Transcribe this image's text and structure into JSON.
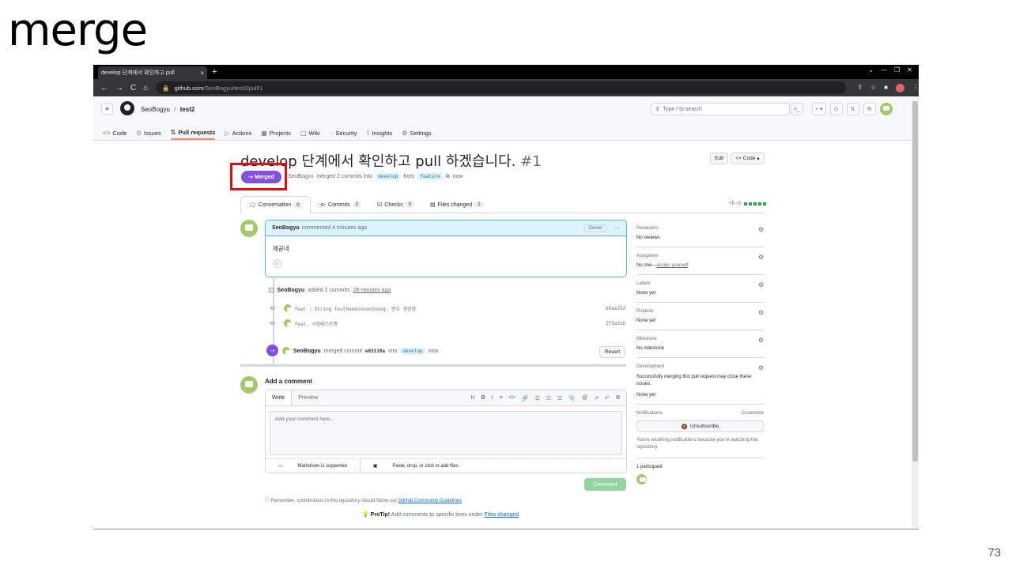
{
  "slide": {
    "title": "merge",
    "page_number": "73"
  },
  "browser": {
    "tab_title": "develop 단계에서 확인하고 pull",
    "tab_close": "×",
    "new_tab": "+",
    "url_host": "github.com",
    "url_path": "/SeoBogyu/test2/pull/1",
    "window_controls": [
      "⌄",
      "—",
      "❐",
      "✕"
    ]
  },
  "github_header": {
    "owner": "SeoBogyu",
    "separator": "/",
    "repo": "test2",
    "search_placeholder": "Type / to search",
    "search_slash": "/",
    "plus": "+ ▾"
  },
  "repo_tabs": [
    {
      "label": "Code",
      "icon": "code-icon",
      "glyph": "<>"
    },
    {
      "label": "Issues",
      "icon": "issue-icon",
      "glyph": "⊙"
    },
    {
      "label": "Pull requests",
      "icon": "pull-request-icon",
      "glyph": "⇅"
    },
    {
      "label": "Actions",
      "icon": "play-icon",
      "glyph": "▷"
    },
    {
      "label": "Projects",
      "icon": "table-icon",
      "glyph": "▦"
    },
    {
      "label": "Wiki",
      "icon": "book-icon",
      "glyph": "▢"
    },
    {
      "label": "Security",
      "icon": "shield-icon",
      "glyph": "◌"
    },
    {
      "label": "Insights",
      "icon": "graph-icon",
      "glyph": "⌇"
    },
    {
      "label": "Settings",
      "icon": "gear-icon",
      "glyph": "⚙"
    }
  ],
  "pr": {
    "title": "develop 단계에서 확인하고 pull 하겠습니다.",
    "number": "#1",
    "status_badge": "Merged",
    "author": "SeoBogyu",
    "merge_text": "merged 2 commits into",
    "base_branch": "develop",
    "from_text": "from",
    "head_branch": "feature",
    "time": "now",
    "edit_label": "Edit",
    "code_label": "Code"
  },
  "pr_tabs": [
    {
      "label": "Conversation",
      "count": "0"
    },
    {
      "label": "Commits",
      "count": "2"
    },
    {
      "label": "Checks",
      "count": "0"
    },
    {
      "label": "Files changed",
      "count": "1"
    }
  ],
  "diffstat": {
    "added": "+5",
    "removed": "−0"
  },
  "comment": {
    "author": "SeoBogyu",
    "meta": "commented 4 minutes ago",
    "badge": "Owner",
    "menu": "···",
    "body": "제곧내"
  },
  "timeline": {
    "commits_event_author": "SeoBogyu",
    "commits_event_text": "added 2 commits",
    "commits_event_time": "28 minutes ago",
    "commits": [
      {
        "message": "feat : String testHaebonuon3oong; 변수 생성함",
        "sha": "b0aa332"
      },
      {
        "message": "feat. 시험테스트중",
        "sha": "2f3a31b"
      }
    ],
    "merge_author": "SeoBogyu",
    "merge_text": "merged commit",
    "merge_sha": "e63110a",
    "merge_into": "into",
    "merge_branch": "develop",
    "merge_time": "now",
    "revert_label": "Revert"
  },
  "add_comment": {
    "title": "Add a comment",
    "tab_write": "Write",
    "tab_preview": "Preview",
    "toolbar": [
      "H",
      "B",
      "I",
      "≡",
      "<>",
      "🔗",
      "☰",
      "☷",
      "☳",
      "📎",
      "@",
      "↗",
      "↶",
      "⧉"
    ],
    "placeholder": "Add your comment here...",
    "markdown_note": "Markdown is supported",
    "attach_note": "Paste, drop, or click to add files",
    "submit_label": "Comment",
    "remember_text": "Remember, contributions to this repository should follow our",
    "guidelines_link": "GitHub Community Guidelines",
    "protip_label": "ProTip!",
    "protip_text": "Add comments to specific lines under",
    "protip_link": "Files changed"
  },
  "sidebar": {
    "reviewers": {
      "label": "Reviewers",
      "value": "No reviews"
    },
    "assignees": {
      "label": "Assignees",
      "value": "No one—",
      "link": "assign yourself"
    },
    "labels": {
      "label": "Labels",
      "value": "None yet"
    },
    "projects": {
      "label": "Projects",
      "value": "None yet"
    },
    "milestone": {
      "label": "Milestone",
      "value": "No milestone"
    },
    "development": {
      "label": "Development",
      "desc": "Successfully merging this pull request may close these issues.",
      "value": "None yet"
    },
    "notifications": {
      "label": "Notifications",
      "customize": "Customize",
      "button": "Unsubscribe",
      "desc": "You're receiving notifications because you're watching this repository."
    },
    "participants": {
      "label": "1 participant"
    }
  },
  "colors": {
    "merged": "#8250df",
    "highlight": "#e01010",
    "accent": "#0969da"
  }
}
